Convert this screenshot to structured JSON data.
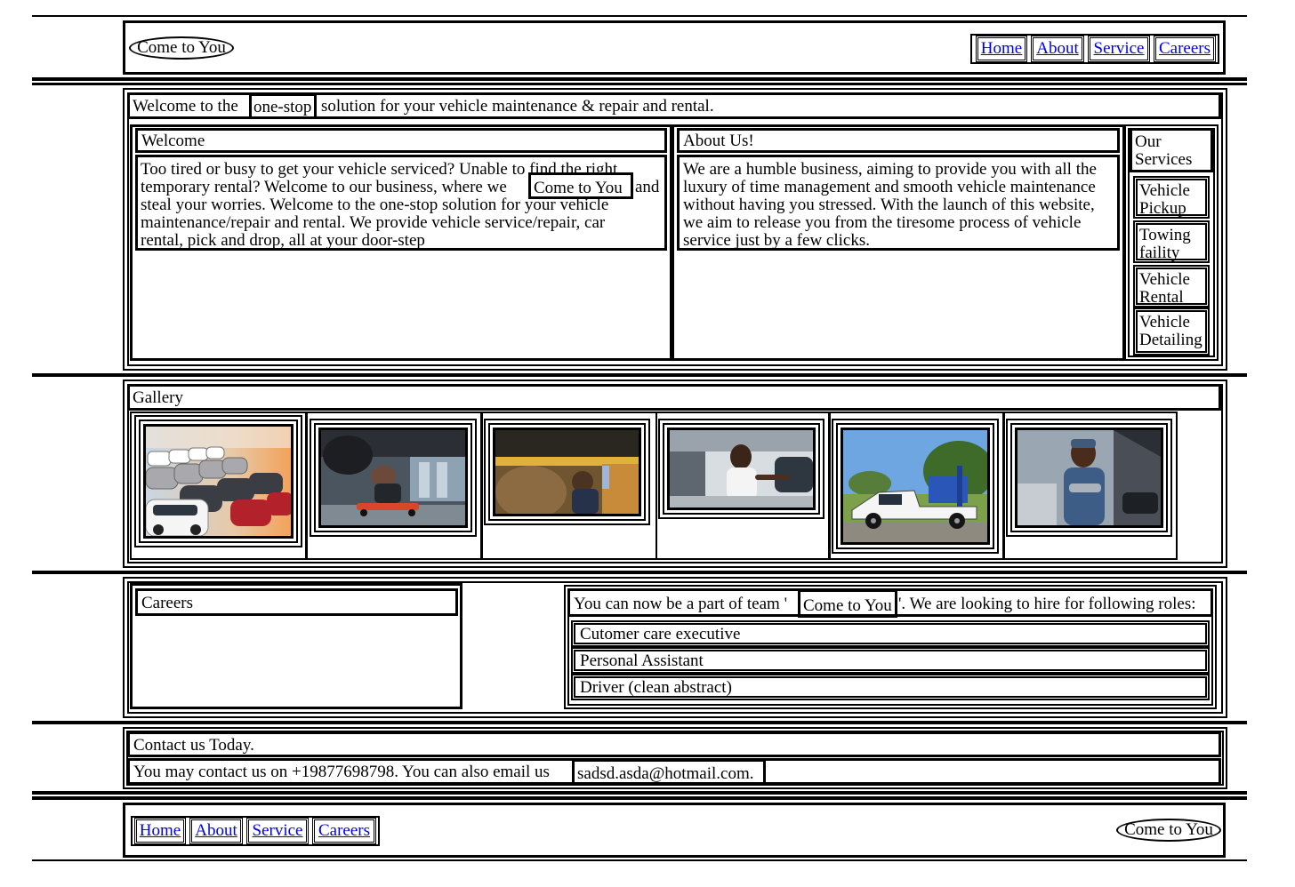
{
  "header": {
    "logo": "Come to You",
    "nav": [
      "Home",
      "About",
      "Service",
      "Careers"
    ]
  },
  "intro": {
    "before": "Welcome to the",
    "highlight": "one-stop",
    "after": "solution for your vehicle maintenance & repair and rental."
  },
  "welcome": {
    "title": "Welcome",
    "line1": "Too tired or busy to get your vehicle serviced? Unable to find the right",
    "line2a": "temporary rental? Welcome to our business, where we",
    "brand": "Come to You",
    "line2b": "and",
    "line3": "steal your worries. Welcome to the one-stop solution for your vehicle",
    "line4": "maintenance/repair and rental. We provide vehicle service/repair, car",
    "line5": "rental, pick and drop, all at your door-step"
  },
  "about": {
    "title": "About Us!",
    "body": "We are a humble business, aiming to provide you with all the luxury of time management and smooth vehicle maintenance without having you stressed. With the launch of this website, we aim to release you from the tiresome process of vehicle service just by a few clicks."
  },
  "services": {
    "title": "Our Services",
    "items": [
      "Vehicle Pickup",
      "Towing faility",
      "Vehicle Rental",
      "Vehicle Detailing"
    ]
  },
  "gallery": {
    "title": "Gallery"
  },
  "careers": {
    "title": "Careers",
    "intro_before": "You can now be a part of team '",
    "brand": "Come to You",
    "intro_after": "'. We are looking to hire for following roles:",
    "roles": [
      "Cutomer care executive",
      "Personal Assistant",
      "Driver (clean abstract)"
    ]
  },
  "contact": {
    "title": "Contact us Today.",
    "text": "You may contact us on +19877698798. You can also email us",
    "email": "sadsd.asda@hotmail.com."
  },
  "footer": {
    "nav": [
      "Home",
      "About",
      "Service",
      "Careers"
    ],
    "logo": "Come to You"
  }
}
